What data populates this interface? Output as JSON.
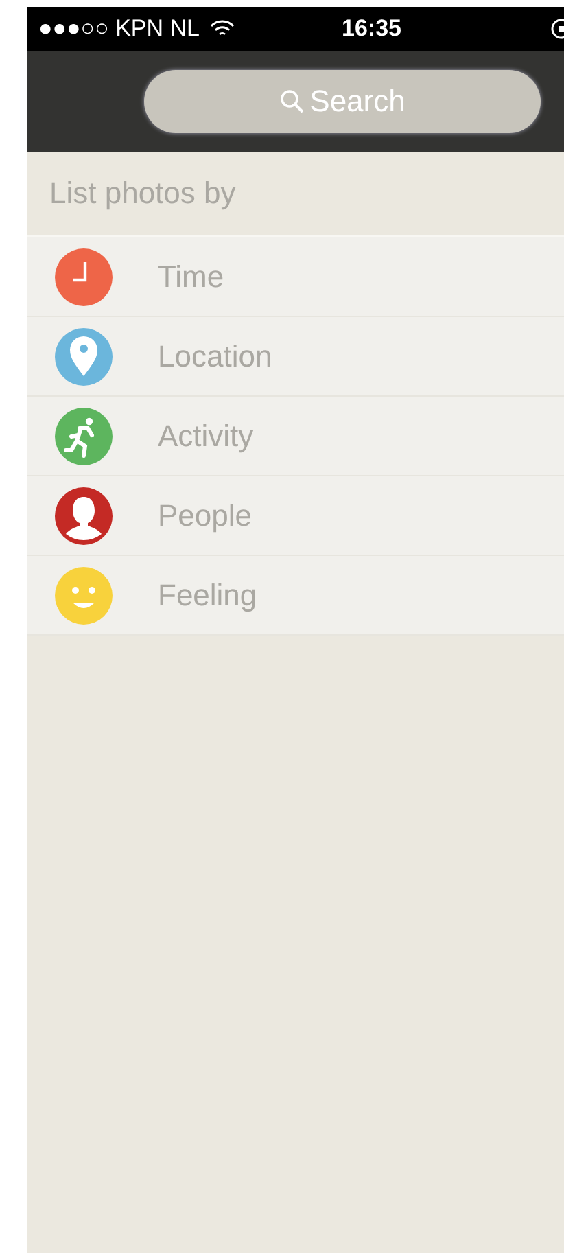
{
  "status_bar": {
    "carrier": "●●●○○ KPN NL",
    "time": "16:35"
  },
  "search": {
    "placeholder": "Search"
  },
  "list": {
    "title": "List photos by",
    "items": [
      {
        "kind": "time",
        "label": "Time",
        "color": "#ee6548"
      },
      {
        "kind": "location",
        "label": "Location",
        "color": "#6bb6dc"
      },
      {
        "kind": "activity",
        "label": "Activity",
        "color": "#5db55e"
      },
      {
        "kind": "people",
        "label": "People",
        "color": "#c42a25"
      },
      {
        "kind": "feeling",
        "label": "Feeling",
        "color": "#f8d23c"
      }
    ]
  }
}
